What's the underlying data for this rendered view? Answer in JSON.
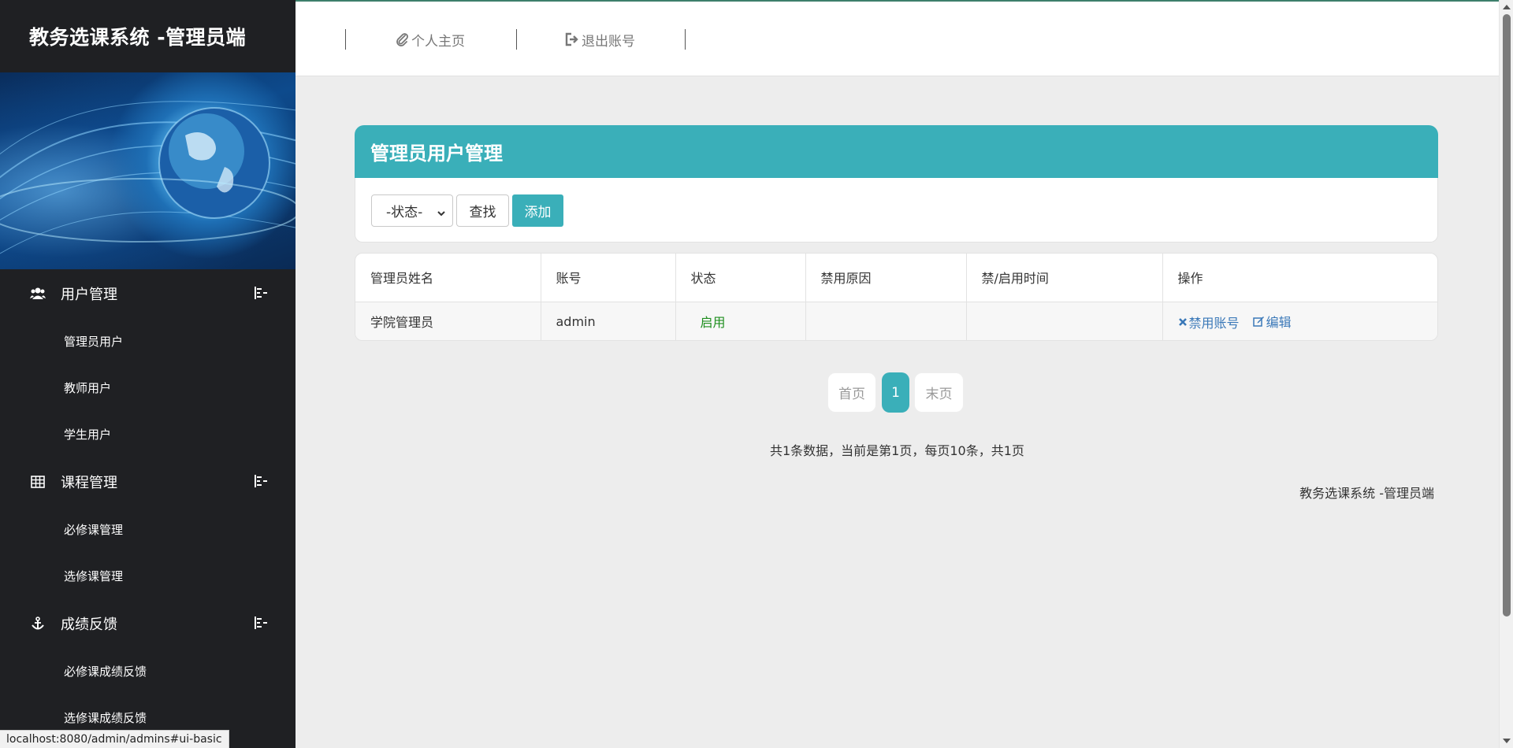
{
  "sidebar": {
    "brand": "教务选课系统 -管理员端",
    "groups": [
      {
        "label": "用户管理",
        "icon": "users-icon",
        "items": [
          "管理员用户",
          "教师用户",
          "学生用户"
        ]
      },
      {
        "label": "课程管理",
        "icon": "table-icon",
        "items": [
          "必修课管理",
          "选修课管理"
        ]
      },
      {
        "label": "成绩反馈",
        "icon": "anchor-icon",
        "items": [
          "必修课成绩反馈",
          "选修课成绩反馈"
        ]
      }
    ],
    "collapse_icon": "collapse-toggle-icon"
  },
  "topbar": {
    "home_label": "个人主页",
    "home_icon": "paperclip-icon",
    "logout_label": "退出账号",
    "logout_icon": "sign-out-icon"
  },
  "panel": {
    "title": "管理员用户管理",
    "status_select_value": "-状态-",
    "search_label": "查找",
    "add_label": "添加"
  },
  "table": {
    "headers": [
      "管理员姓名",
      "账号",
      "状态",
      "禁用原因",
      "禁/启用时间",
      "操作"
    ],
    "rows": [
      {
        "name": "学院管理员",
        "account": "admin",
        "status": "启用",
        "reason": "",
        "time": "",
        "actions": [
          "禁用账号",
          "编辑"
        ]
      }
    ]
  },
  "pagination": {
    "first": "首页",
    "current": "1",
    "last": "末页",
    "summary": "共1条数据，当前是第1页，每页10条，共1页"
  },
  "footer": "教务选课系统 -管理员端",
  "status_bar_url": "localhost:8080/admin/admins#ui-basic",
  "colors": {
    "sidebar_bg": "#1f2023",
    "accent": "#3aafb9",
    "enabled_status": "#1f8f1f",
    "link": "#3a78b8"
  }
}
